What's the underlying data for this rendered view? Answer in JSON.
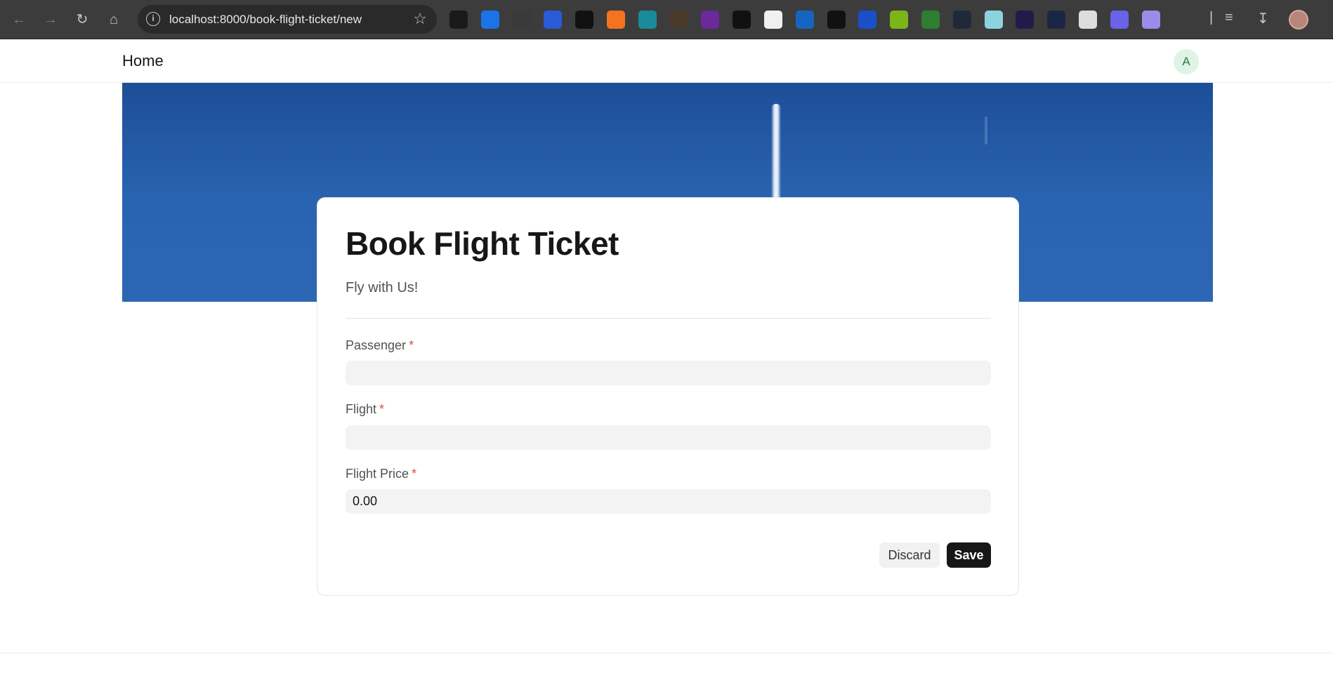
{
  "browser": {
    "url": "localhost:8000/book-flight-ticket/new",
    "extensions": [
      {
        "icon": "grid-dots-extension-icon",
        "color": "#1a1a1a"
      },
      {
        "icon": "shield-extension-icon",
        "color": "#1a73e8"
      },
      {
        "icon": "dice-extension-icon",
        "color": "#3a3a3a"
      },
      {
        "icon": "wave-extension-icon",
        "color": "#2a5bd7"
      },
      {
        "icon": "p-logo-extension-icon",
        "color": "#111111"
      },
      {
        "icon": "camera-extension-icon",
        "color": "#f37321"
      },
      {
        "icon": "ocean-extension-icon",
        "color": "#1b8a9a"
      },
      {
        "icon": "n-script-extension-icon",
        "color": "#4a3a2a"
      },
      {
        "icon": "pixel-extension-icon",
        "color": "#6a2a9a"
      },
      {
        "icon": "a-letter-extension-icon",
        "color": "#111111"
      },
      {
        "icon": "slash-circle-extension-icon",
        "color": "#f0f0f0"
      },
      {
        "icon": "s-badge-extension-icon",
        "color": "#1565c0"
      },
      {
        "icon": "lines-extension-icon",
        "color": "#111111"
      },
      {
        "icon": "snowflake-extension-icon",
        "color": "#1a4fc9"
      },
      {
        "icon": "green-circle-extension-icon",
        "color": "#7cb518"
      },
      {
        "icon": "diamond-extension-icon",
        "color": "#2e7d32"
      },
      {
        "icon": "dot-extension-icon",
        "color": "#1e2a3a"
      },
      {
        "icon": "stack-extension-icon",
        "color": "#8ad4e0"
      },
      {
        "icon": "purple-orb-extension-icon",
        "color": "#241a4a"
      },
      {
        "icon": "hash-extension-icon",
        "color": "#1a2744"
      },
      {
        "icon": "pencil-extension-icon",
        "color": "#dddddd"
      },
      {
        "icon": "arrows-extension-icon",
        "color": "#6a62e8"
      },
      {
        "icon": "ghost-extension-icon",
        "color": "#9c8be8"
      },
      {
        "icon": "puzzle-extension-icon",
        "color": "#3c3c3c"
      }
    ]
  },
  "nav": {
    "home": "Home",
    "avatar_initial": "A"
  },
  "form": {
    "title": "Book Flight Ticket",
    "subtitle": "Fly with Us!",
    "fields": [
      {
        "label": "Passenger",
        "required": "*",
        "value": ""
      },
      {
        "label": "Flight",
        "required": "*",
        "value": ""
      },
      {
        "label": "Flight Price",
        "required": "*",
        "value": "0.00"
      }
    ],
    "discard_label": "Discard",
    "save_label": "Save"
  }
}
